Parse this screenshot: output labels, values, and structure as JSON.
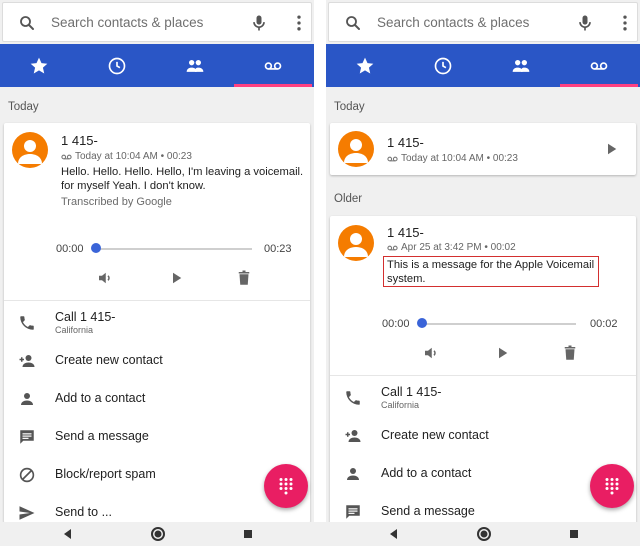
{
  "search": {
    "placeholder": "Search contacts & places"
  },
  "tabs": [
    {
      "icon": "star-icon",
      "label": "Speed dial"
    },
    {
      "icon": "clock-icon",
      "label": "Recents"
    },
    {
      "icon": "people-icon",
      "label": "Contacts"
    },
    {
      "icon": "voicemail-icon",
      "label": "Voicemail",
      "selected": true
    }
  ],
  "left": {
    "section_today": "Today",
    "voicemail": {
      "name": "1 415-",
      "meta": "Today at 10:04 AM • 00:23",
      "transcript": "Hello. Hello. Hello. Hello, I'm leaving a voicemail. for myself Yeah. I don't know.",
      "transcribed_by": "Transcribed by Google",
      "time_current": "00:00",
      "time_total": "00:23",
      "progress": 0.0
    },
    "actions": [
      {
        "icon": "phone-icon",
        "label": "Call 1 415-",
        "sub": "California"
      },
      {
        "icon": "add-person-icon",
        "label": "Create new contact"
      },
      {
        "icon": "person-icon",
        "label": "Add to a contact"
      },
      {
        "icon": "message-icon",
        "label": "Send a message"
      },
      {
        "icon": "block-icon",
        "label": "Block/report spam"
      },
      {
        "icon": "send-icon",
        "label": "Send to ..."
      }
    ]
  },
  "right": {
    "section_today": "Today",
    "collapsed_voicemail": {
      "name": "1 415-",
      "meta": "Today at 10:04 AM • 00:23"
    },
    "section_older": "Older",
    "voicemail": {
      "name": "1 415-",
      "meta": "Apr 25 at 3:42 PM • 00:02",
      "transcript": "This is a message for the Apple Voicemail system.",
      "time_current": "00:00",
      "time_total": "00:02",
      "progress": 0.0
    },
    "actions": [
      {
        "icon": "phone-icon",
        "label": "Call 1 415-",
        "sub": "California"
      },
      {
        "icon": "add-person-icon",
        "label": "Create new contact"
      },
      {
        "icon": "person-icon",
        "label": "Add to a contact"
      },
      {
        "icon": "message-icon",
        "label": "Send a message"
      }
    ]
  },
  "colors": {
    "tabbar": "#2a56c6",
    "indicator": "#ff4081",
    "avatar": "#f57c00",
    "fab": "#e91e63",
    "highlight": "#d32f2f"
  }
}
